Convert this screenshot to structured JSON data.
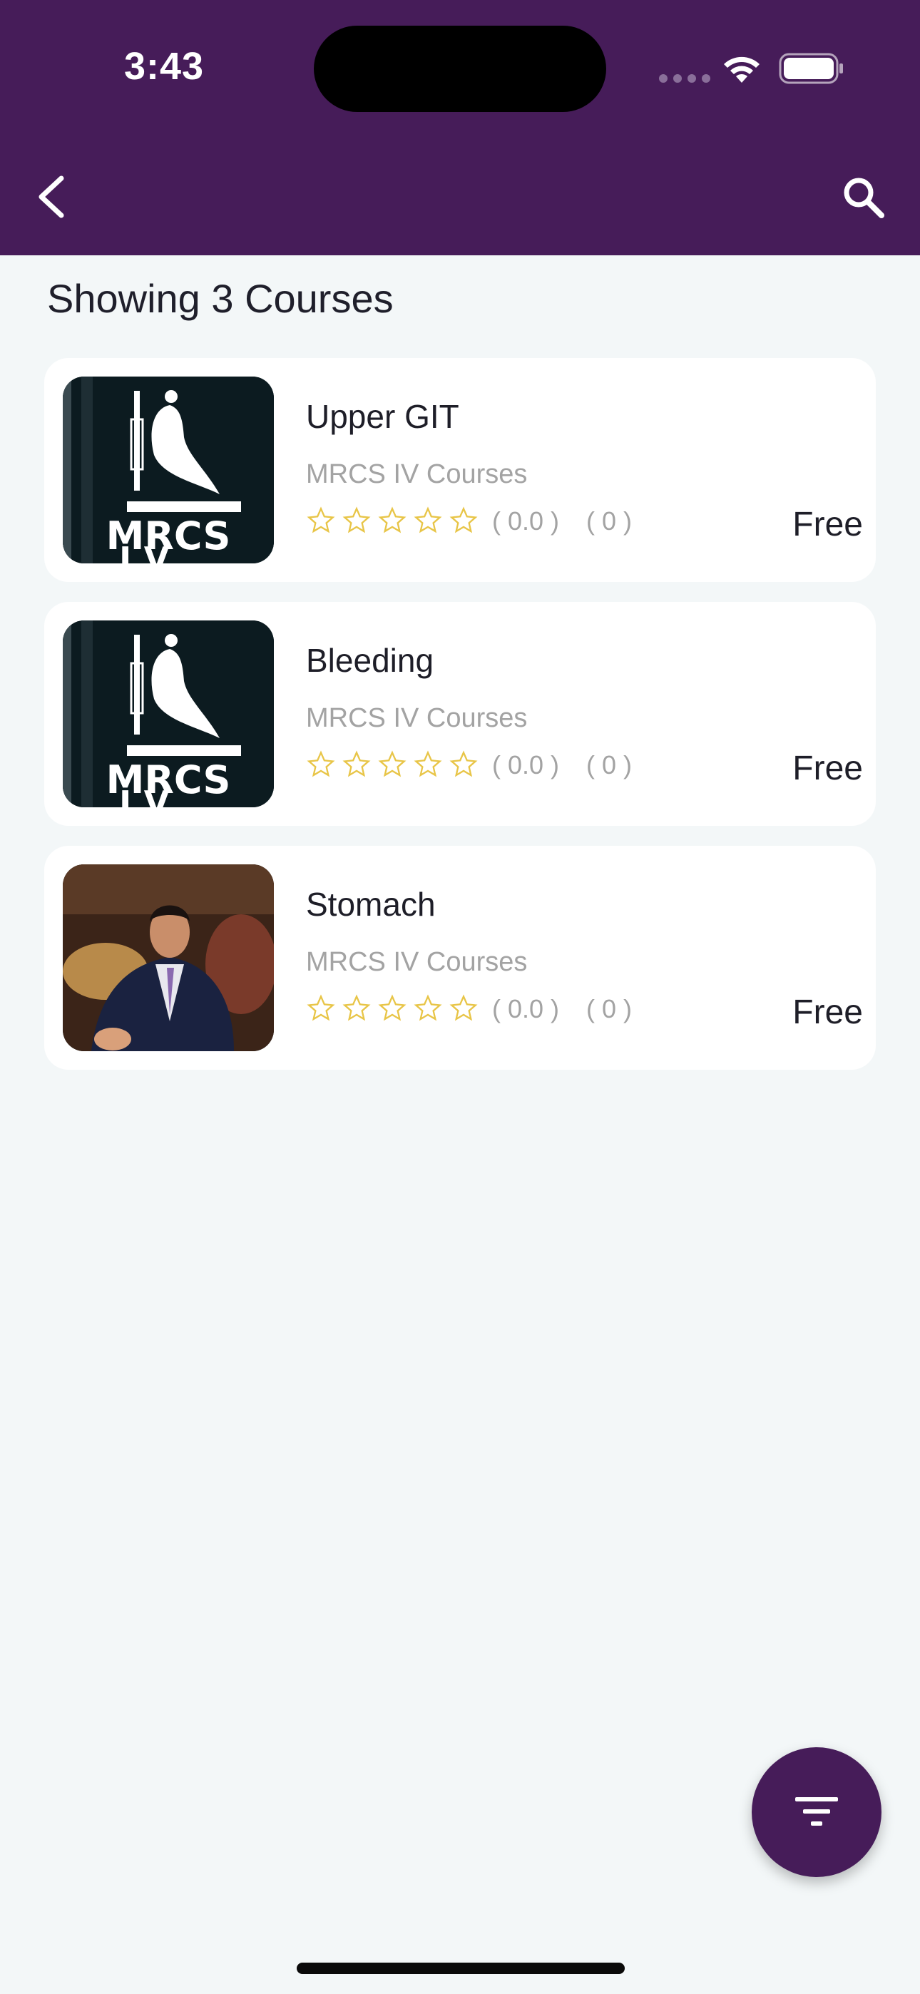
{
  "status_bar": {
    "time": "3:43"
  },
  "header": {
    "back_icon": "chevron-left-icon",
    "search_icon": "search-icon"
  },
  "summary": {
    "count_text": "Showing 3 Courses"
  },
  "courses": [
    {
      "title": "Upper GIT",
      "category": "MRCS IV Courses",
      "rating": 0,
      "rating_text": "( 0.0 )",
      "reviews_text": "( 0 )",
      "price": "Free",
      "thumb_text_1": "MRCS",
      "thumb_text_2": "I.V."
    },
    {
      "title": "Bleeding",
      "category": "MRCS IV Courses",
      "rating": 0,
      "rating_text": "( 0.0 )",
      "reviews_text": "( 0 )",
      "price": "Free",
      "thumb_text_1": "MRCS",
      "thumb_text_2": "I.V."
    },
    {
      "title": "Stomach",
      "category": "MRCS IV Courses",
      "rating": 0,
      "rating_text": "( 0.0 )",
      "reviews_text": "( 0 )",
      "price": "Free"
    }
  ],
  "fab": {
    "icon": "filter-icon"
  },
  "colors": {
    "brand": "#461c59",
    "star": "#e8c547",
    "muted": "#a3a3a3",
    "background": "#f3f7f8"
  }
}
